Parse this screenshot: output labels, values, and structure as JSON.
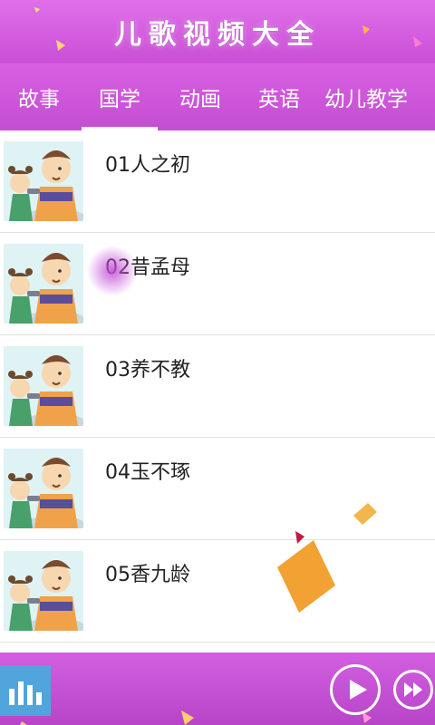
{
  "header": {
    "title": "儿歌视频大全"
  },
  "tabs": [
    {
      "label": "故事"
    },
    {
      "label": "国学"
    },
    {
      "label": "动画"
    },
    {
      "label": "英语"
    },
    {
      "label": "幼儿教学"
    }
  ],
  "active_tab": "国学",
  "list": [
    {
      "title": "01人之初"
    },
    {
      "title": "02昔孟母"
    },
    {
      "title": "03养不教"
    },
    {
      "title": "04玉不琢"
    },
    {
      "title": "05香九龄"
    }
  ],
  "player": {
    "icons": [
      "equalizer-icon",
      "play-icon",
      "fast-forward-icon"
    ]
  },
  "colors": {
    "header_bg": "#d85fe3",
    "accent_blue": "#4fa5dc",
    "text": "#222222"
  }
}
